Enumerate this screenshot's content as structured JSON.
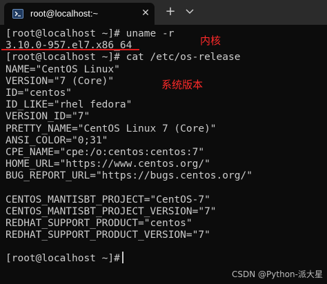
{
  "window": {
    "tab_title": "root@localhost:~",
    "close_glyph": "✕",
    "new_tab_glyph": "+"
  },
  "terminal": {
    "lines": [
      "[root@localhost ~]# uname -r",
      "3.10.0-957.el7.x86_64",
      "[root@localhost ~]# cat /etc/os-release",
      "NAME=\"CentOS Linux\"",
      "VERSION=\"7 (Core)\"",
      "ID=\"centos\"",
      "ID_LIKE=\"rhel fedora\"",
      "VERSION_ID=\"7\"",
      "PRETTY_NAME=\"CentOS Linux 7 (Core)\"",
      "ANSI_COLOR=\"0;31\"",
      "CPE_NAME=\"cpe:/o:centos:centos:7\"",
      "HOME_URL=\"https://www.centos.org/\"",
      "BUG_REPORT_URL=\"https://bugs.centos.org/\"",
      "",
      "CENTOS_MANTISBT_PROJECT=\"CentOS-7\"",
      "CENTOS_MANTISBT_PROJECT_VERSION=\"7\"",
      "REDHAT_SUPPORT_PRODUCT=\"centos\"",
      "REDHAT_SUPPORT_PRODUCT_VERSION=\"7\"",
      "",
      "[root@localhost ~]#"
    ]
  },
  "annotations": {
    "kernel": "内核",
    "version": "系统版本"
  },
  "watermark": "CSDN @Python-派大星",
  "colors": {
    "background": "#0c0c0c",
    "titlebar": "#2b2b2b",
    "text": "#cccccc",
    "annotation": "#ff2a2a"
  }
}
